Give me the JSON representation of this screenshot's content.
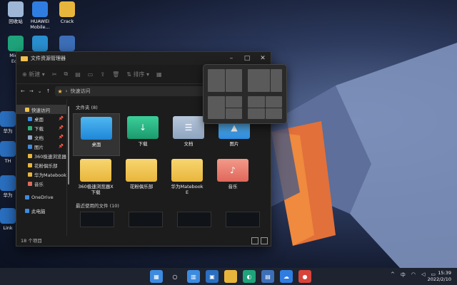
{
  "desktop": {
    "icons": [
      {
        "label": "回收站",
        "color": "#9fb7d6"
      },
      {
        "label": "HUAWEI\nMobile...",
        "color": "#2f7de0"
      },
      {
        "label": "Crack",
        "color": "#e8b53c"
      },
      {
        "label": "Micro\nEdg",
        "color": "#1fa37a"
      },
      {
        "label": "",
        "color": "#2a8fd0"
      },
      {
        "label": "",
        "color": "#3d6fb8"
      }
    ],
    "left_partial_labels": [
      "华为",
      "TH",
      "华为",
      "Link"
    ]
  },
  "explorer": {
    "title": "文件资源管理器",
    "toolbar": {
      "new_label": "新建",
      "sort_label": "排序",
      "view_label": "查看"
    },
    "address": "快速访问",
    "nav": [
      {
        "label": "快速访问",
        "color": "#f0c04c",
        "sel": true
      },
      {
        "label": "桌面",
        "color": "#3d8be0",
        "pin": true
      },
      {
        "label": "下载",
        "color": "#2fb07a",
        "pin": true
      },
      {
        "label": "文档",
        "color": "#8fa8c8",
        "pin": true
      },
      {
        "label": "图片",
        "color": "#3d8be0",
        "pin": true
      },
      {
        "label": "360极速浏览器",
        "color": "#e8b53c"
      },
      {
        "label": "花粉俱乐部",
        "color": "#e8b53c"
      },
      {
        "label": "华为Matebook",
        "color": "#e8b53c"
      },
      {
        "label": "音乐",
        "color": "#e06a5a"
      },
      {
        "label": "OneDrive",
        "color": "#3d8be0"
      },
      {
        "label": "此电脑",
        "color": "#3d8be0"
      }
    ],
    "folders_header": "文件夹 (8)",
    "folders": [
      {
        "label": "桌面",
        "kind": "desktop"
      },
      {
        "label": "下载",
        "kind": "download"
      },
      {
        "label": "文档",
        "kind": "document"
      },
      {
        "label": "图片",
        "kind": "picture"
      },
      {
        "label": "360极速浏览器X\n下载",
        "kind": "yellow"
      },
      {
        "label": "花粉俱乐部",
        "kind": "yellow"
      },
      {
        "label": "华为Matebook\nE",
        "kind": "yellow"
      },
      {
        "label": "音乐",
        "kind": "music"
      }
    ],
    "recent_header": "最近使用的文件 (10)",
    "status": "18 个项目"
  },
  "taskbar": {
    "icons": [
      "start",
      "search",
      "widgets",
      "taskview",
      "explorer",
      "edge",
      "store",
      "huawei",
      "app"
    ],
    "tray": [
      "^",
      "中",
      "wifi",
      "vol",
      "bat"
    ],
    "time": "15:39",
    "date": "2022/2/10"
  }
}
